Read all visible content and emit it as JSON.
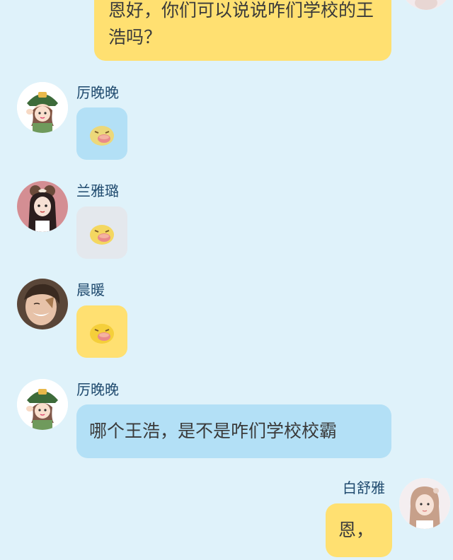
{
  "messages": [
    {
      "text": "恩好，你们可以说说咋们学校的王浩吗？"
    },
    {
      "sender": "厉晚晚",
      "sticker": "crying-chick-sticker"
    },
    {
      "sender": "兰雅璐",
      "sticker": "crying-chick-sticker"
    },
    {
      "sender": "晨暖",
      "sticker": "crying-chick-sticker"
    },
    {
      "sender": "厉晚晚",
      "text": "哪个王浩，是不是咋们学校校霸"
    },
    {
      "sender": "白舒雅",
      "text": "恩，"
    }
  ],
  "colors": {
    "background": "#dff2fa",
    "outgoing_bubble": "#ffe071",
    "incoming_bubble": "#b3e0f6",
    "sender_name": "#1f4a6e"
  }
}
